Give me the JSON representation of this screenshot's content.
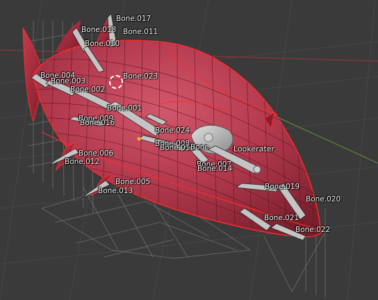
{
  "viewport": {
    "background": "#3a3a3a",
    "grid_color": "#4a4a4a",
    "axis_x_color": "#a03a3a",
    "axis_y_color": "#6a9a3a",
    "mesh_color": "#b8344a",
    "outline_color": "#ff2020",
    "bone_color": "#c8c8c8"
  },
  "bones": {
    "b017": "Bone.017",
    "b018": "Bone.018",
    "b011": "Bone.011",
    "b010": "Bone.010",
    "b004": "Bone.004",
    "b003": "Bone.003",
    "b002": "Bone.002",
    "b023": "Bone.023",
    "b001": "Bone.001",
    "b009": "Bone.009",
    "b016": "Bone.016",
    "b024": "Bone.024",
    "b008": "Bone.008",
    "b015": "Bone.015",
    "bone": "Bone",
    "lookerater": "Lookerater",
    "b006": "Bone.006",
    "b012": "Bone.012",
    "b007": "Bone.007",
    "b014": "Bone.014",
    "b005": "Bone.005",
    "b013": "Bone.013",
    "b019": "Bone.019",
    "b020": "Bone.020",
    "b021": "Bone.021",
    "b022": "Bone.022"
  }
}
